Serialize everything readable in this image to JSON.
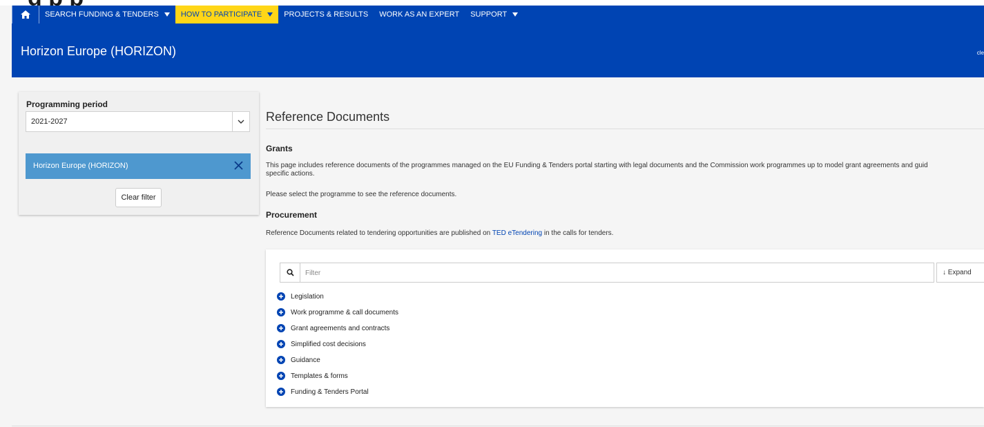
{
  "top_partial_heading": "g                  p                  p",
  "nav": {
    "items": [
      {
        "label": "SEARCH FUNDING & TENDERS",
        "has_caret": true,
        "active": false
      },
      {
        "label": "HOW TO PARTICIPATE",
        "has_caret": true,
        "active": true
      },
      {
        "label": "PROJECTS & RESULTS",
        "has_caret": false,
        "active": false
      },
      {
        "label": "WORK AS AN EXPERT",
        "has_caret": false,
        "active": false
      },
      {
        "label": "SUPPORT",
        "has_caret": true,
        "active": false
      }
    ],
    "home_icon": "home-icon"
  },
  "banner": {
    "title": "Horizon Europe (HORIZON)",
    "right_text": "cle"
  },
  "sidebar": {
    "period_label": "Programming period",
    "period_value": "2021-2027",
    "selected_programme": "Horizon Europe (HORIZON)",
    "clear_label": "Clear filter"
  },
  "main": {
    "title": "Reference Documents",
    "grants_heading": "Grants",
    "grants_text_1": "This page includes reference documents of the programmes managed on the EU Funding & Tenders portal starting with legal documents and the Commission work programmes up to model grant agreements and guid",
    "grants_text_2": "specific actions.",
    "select_text": "Please select the programme to see the reference documents.",
    "procurement_heading": "Procurement",
    "procurement_text_before": "Reference Documents related to tendering opportunities are published on ",
    "procurement_link": "TED eTendering",
    "procurement_text_after": " in the calls for tenders."
  },
  "panel": {
    "filter_placeholder": "Filter",
    "expand_label": "↓ Expand",
    "items": [
      "Legislation",
      "Work programme & call documents",
      "Grant agreements and contracts",
      "Simplified cost decisions",
      "Guidance",
      "Templates & forms",
      "Funding & Tenders Portal"
    ]
  },
  "colors": {
    "brand_blue": "#0044b3",
    "active_yellow": "#ffd617",
    "chip_blue": "#4e98cf"
  }
}
